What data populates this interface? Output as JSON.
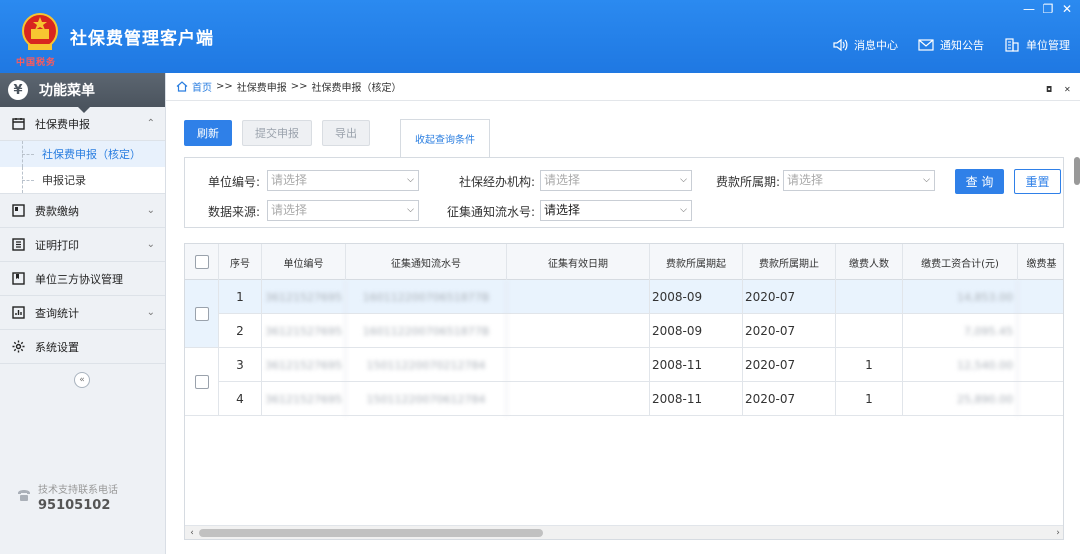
{
  "app": {
    "title": "社保费管理客户端",
    "emblem_caption": "中国税务",
    "window_controls": [
      "—",
      "❐",
      "✕"
    ]
  },
  "top_links": [
    {
      "icon": "speaker-icon",
      "label": "消息中心"
    },
    {
      "icon": "mail-icon",
      "label": "通知公告"
    },
    {
      "icon": "building-icon",
      "label": "单位管理"
    }
  ],
  "sidebar": {
    "header": "功能菜单",
    "items": [
      {
        "label": "社保费申报",
        "icon": "calendar-icon",
        "expanded": true,
        "children": [
          {
            "label": "社保费申报（核定）",
            "active": true
          },
          {
            "label": "申报记录",
            "active": false
          }
        ]
      },
      {
        "label": "费款缴纳",
        "icon": "card-icon",
        "chevron": "⌄"
      },
      {
        "label": "证明打印",
        "icon": "document-icon",
        "chevron": "⌄"
      },
      {
        "label": "单位三方协议管理",
        "icon": "bookmark-icon"
      },
      {
        "label": "查询统计",
        "icon": "chart-icon",
        "chevron": "⌄"
      },
      {
        "label": "系统设置",
        "icon": "gear-icon"
      }
    ],
    "collapse_glyph": "«",
    "support_label": "技术支持联系电话",
    "support_phone": "95105102"
  },
  "breadcrumb": {
    "home": "首页",
    "sep": ">>",
    "level1": "社保费申报",
    "level2": "社保费申报（核定）"
  },
  "toolbar": {
    "refresh": "刷新",
    "submit": "提交申报",
    "export": "导出",
    "collapse_tab": "收起查询条件"
  },
  "filters": {
    "unit_code_label": "单位编号:",
    "agency_label": "社保经办机构:",
    "period_label": "费款所属期:",
    "source_label": "数据来源:",
    "notice_label": "征集通知流水号:",
    "placeholder": "请选择",
    "notice_value": "请选择",
    "query": "查 询",
    "reset": "重置"
  },
  "table": {
    "headers": [
      "序号",
      "单位编号",
      "征集通知流水号",
      "征集有效日期",
      "费款所属期起",
      "费款所属期止",
      "缴费人数",
      "缴费工资合计(元)",
      "缴费基"
    ],
    "rows": [
      {
        "no": "1",
        "unit": "36121527695",
        "notice": "16011220070651877B",
        "valid": "",
        "start": "2008-09",
        "end": "2020-07",
        "count": "",
        "wage": "14,853.00"
      },
      {
        "no": "2",
        "unit": "36121527695",
        "notice": "16011220070651877B",
        "valid": "",
        "start": "2008-09",
        "end": "2020-07",
        "count": "",
        "wage": "7,095.45"
      },
      {
        "no": "3",
        "unit": "36121527695",
        "notice": "15011220070212784",
        "valid": "",
        "start": "2008-11",
        "end": "2020-07",
        "count": "1",
        "wage": "12,540.00"
      },
      {
        "no": "4",
        "unit": "36121527695",
        "notice": "15011220070612784",
        "valid": "",
        "start": "2008-11",
        "end": "2020-07",
        "count": "1",
        "wage": "25,890.00"
      }
    ]
  },
  "scroll": {
    "left": "‹",
    "right": "›"
  }
}
